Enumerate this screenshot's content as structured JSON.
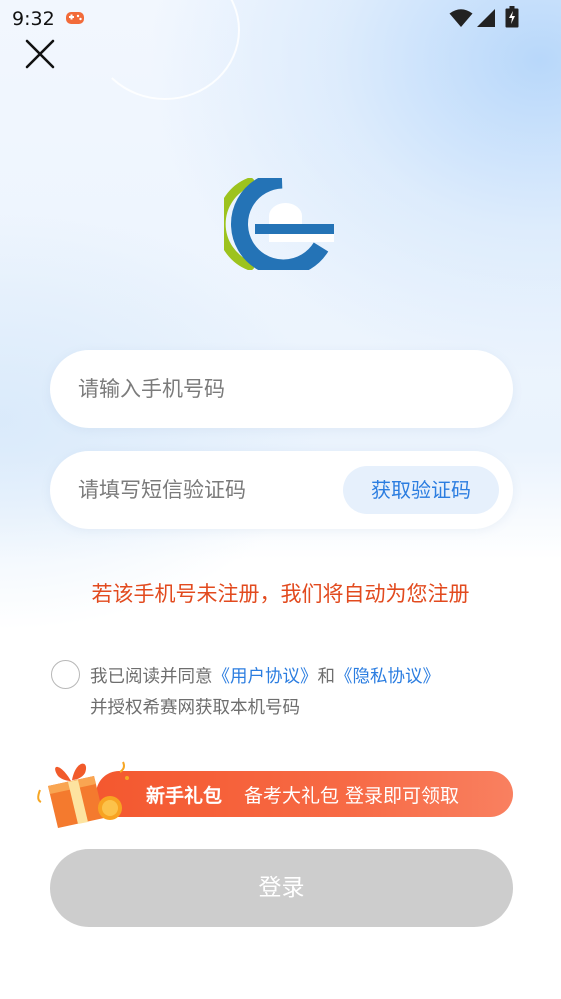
{
  "status_bar": {
    "time": "9:32",
    "icons": [
      "game-icon",
      "wifi-icon",
      "signal-icon",
      "battery-icon"
    ]
  },
  "header": {
    "close_icon": "close-icon"
  },
  "logo": {
    "icon": "brand-e-logo",
    "colors": {
      "blue": "#2473b6",
      "green": "#9dc31e"
    }
  },
  "form": {
    "phone_placeholder": "请输入手机号码",
    "phone_value": "",
    "code_placeholder": "请填写短信验证码",
    "code_value": "",
    "get_code_label": "获取验证码"
  },
  "notice": "若该手机号未注册，我们将自动为您注册",
  "agreement": {
    "checked": false,
    "prefix": "我已阅读并同意",
    "user_agreement": "《用户协议》",
    "and": "和",
    "privacy_agreement": "《隐私协议》",
    "line2": "并授权希赛网获取本机号码"
  },
  "gift_banner": {
    "title": "新手礼包",
    "subtitle": "备考大礼包 登录即可领取",
    "icon": "gift-box-icon"
  },
  "login_button": "登录",
  "colors": {
    "accent_blue": "#2b7de0",
    "notice_red": "#e24a1e",
    "banner_orange": "#f4582f",
    "login_disabled": "#cdcdcd"
  }
}
